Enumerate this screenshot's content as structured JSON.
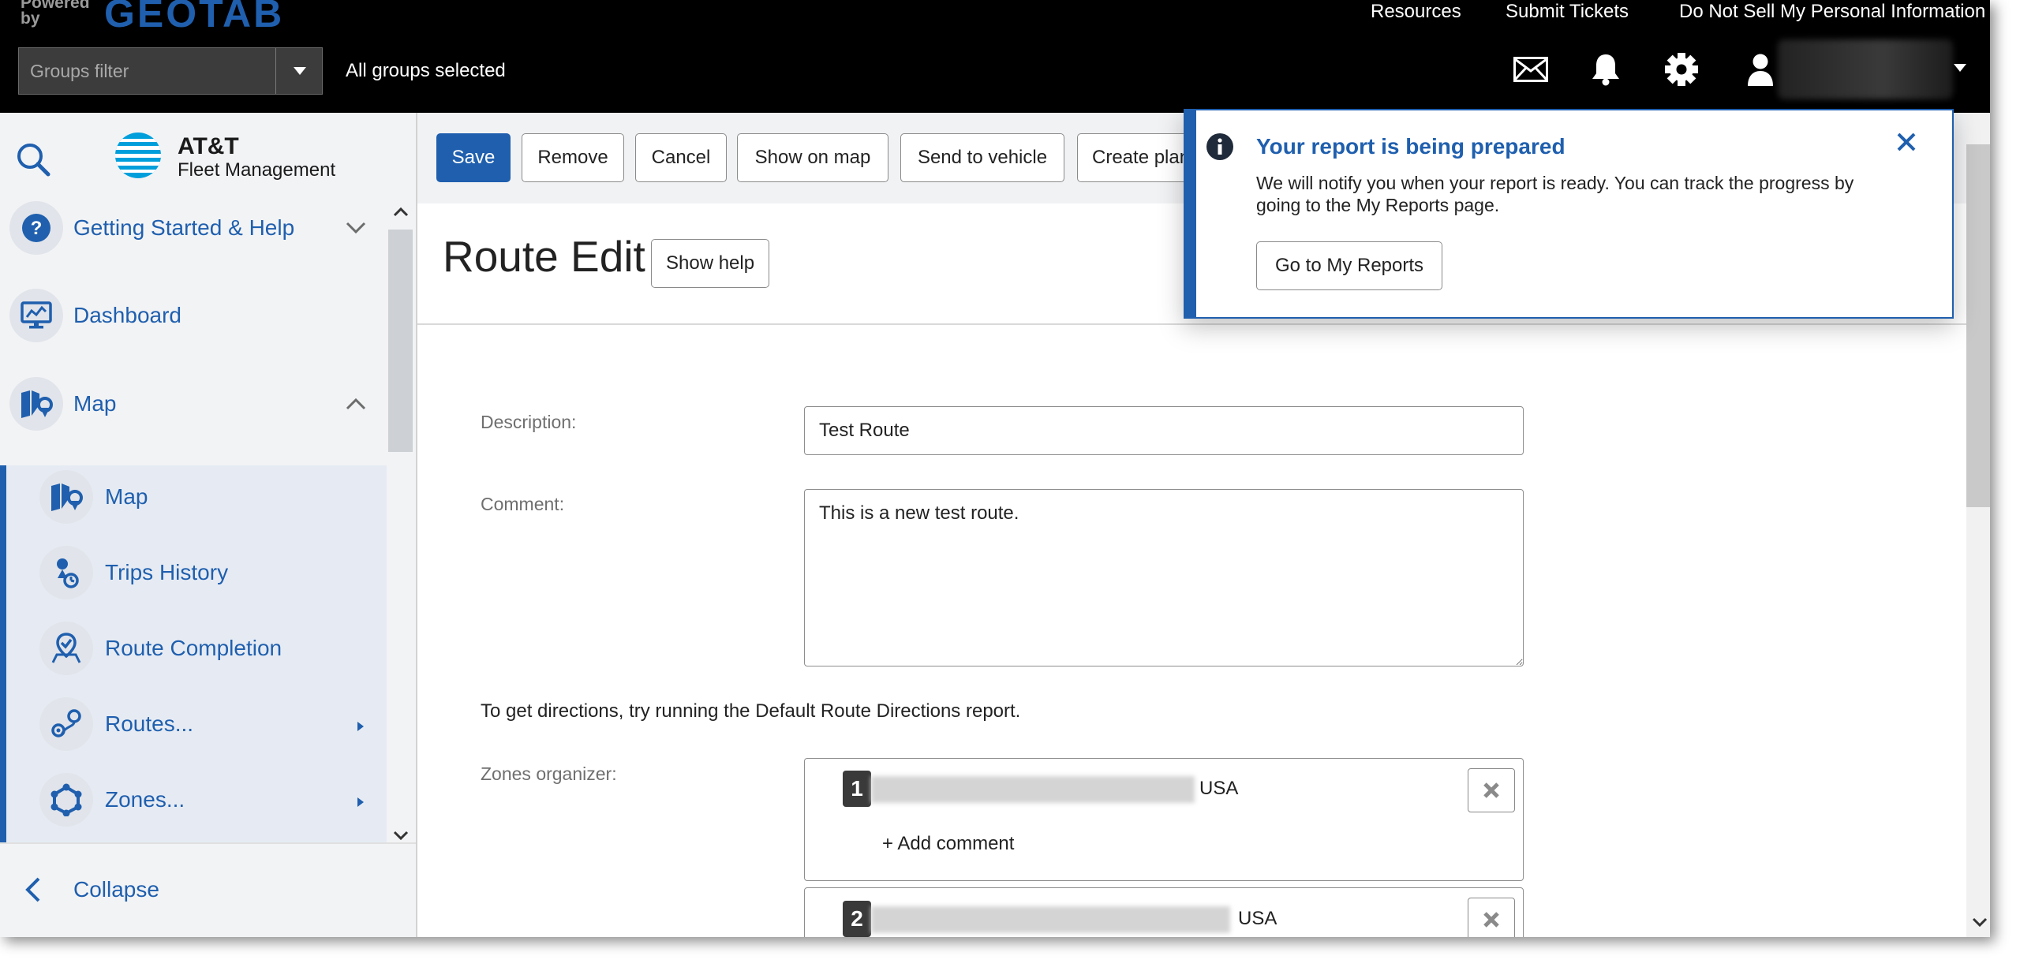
{
  "topbar": {
    "powered_by": "Powered by",
    "brand": "GEOTAB",
    "links": [
      "Resources",
      "Submit Tickets",
      "Do Not Sell My Personal Information"
    ],
    "groups_filter_placeholder": "Groups filter",
    "groups_status": "All groups selected",
    "icons": [
      "mail-icon",
      "bell-icon",
      "gear-icon",
      "user-icon"
    ]
  },
  "sidebar": {
    "brand_line1": "AT&T",
    "brand_line2": "Fleet Management",
    "items": [
      {
        "label": "Getting Started & Help",
        "icon": "help-icon"
      },
      {
        "label": "Dashboard",
        "icon": "dashboard-icon"
      },
      {
        "label": "Map",
        "icon": "map-icon"
      }
    ],
    "subitems": [
      {
        "label": "Map",
        "icon": "map-icon"
      },
      {
        "label": "Trips History",
        "icon": "trips-history-icon"
      },
      {
        "label": "Route Completion",
        "icon": "route-completion-icon"
      },
      {
        "label": "Routes...",
        "icon": "routes-icon"
      },
      {
        "label": "Zones...",
        "icon": "zones-icon"
      }
    ],
    "collapse_label": "Collapse"
  },
  "toolbar": {
    "save": "Save",
    "remove": "Remove",
    "cancel": "Cancel",
    "show_on_map": "Show on map",
    "send_to_vehicle": "Send to vehicle",
    "create_plan": "Create plan"
  },
  "page": {
    "title": "Route Edit",
    "show_help": "Show help"
  },
  "form": {
    "description_label": "Description:",
    "description_value": "Test Route",
    "comment_label": "Comment:",
    "comment_value": "This is a new test route.",
    "directions_text": "To get directions, try running the Default Route Directions report.",
    "zones_label": "Zones organizer:",
    "zones": [
      {
        "number": "1",
        "country": "USA",
        "add_comment": "+ Add comment"
      },
      {
        "number": "2",
        "country": "USA"
      }
    ]
  },
  "notification": {
    "title": "Your report is being prepared",
    "body": "We will notify you when your report is ready. You can track the progress by going to the My Reports page.",
    "button": "Go to My Reports"
  },
  "colors": {
    "accent": "#1f5fae",
    "topbar": "#000000",
    "sidebar_bg": "#f2f3f5"
  }
}
